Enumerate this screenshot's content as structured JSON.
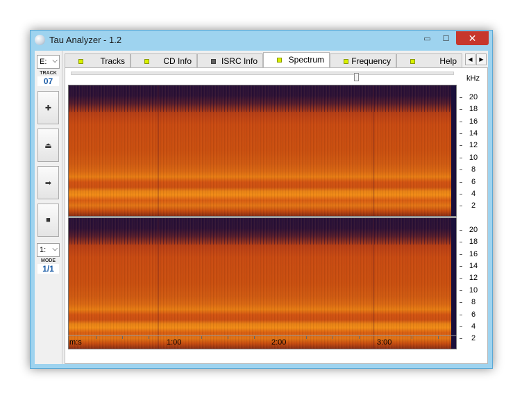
{
  "window": {
    "title": "Tau Analyzer - 1.2",
    "controls": {
      "minimize": "▭",
      "maximize": "☐",
      "close": "✕"
    }
  },
  "sidebar": {
    "drive_value": "E:",
    "track_label": "TRACK",
    "track_value": "07",
    "buttons": [
      {
        "name": "add-button",
        "glyph": "✚"
      },
      {
        "name": "eject-button",
        "glyph": "⏏"
      },
      {
        "name": "play-button",
        "glyph": "➡"
      },
      {
        "name": "stop-button",
        "glyph": "■"
      }
    ],
    "mode_select_value": "1:",
    "mode_label": "MODE",
    "mode_value": "1/1"
  },
  "tabs": [
    {
      "label": "Tracks",
      "indicator": "yellow",
      "active": false
    },
    {
      "label": "CD Info",
      "indicator": "yellow",
      "active": false
    },
    {
      "label": "ISRC Info",
      "indicator": "grey",
      "active": false
    },
    {
      "label": "Spectrum",
      "indicator": "yellow",
      "active": true
    },
    {
      "label": "Frequency",
      "indicator": "yellow",
      "active": false
    },
    {
      "label": "Help",
      "indicator": "yellow",
      "active": false
    }
  ],
  "tab_scroll": {
    "left": "◀",
    "right": "▶"
  },
  "spectrum": {
    "position_fraction": 0.75,
    "unit": "kHz",
    "freq_ticks": [
      "20",
      "18",
      "16",
      "14",
      "12",
      "10",
      "8",
      "6",
      "4",
      "2"
    ],
    "time_axis_label": "m:s",
    "time_ticks": [
      "1:00",
      "2:00",
      "3:00"
    ],
    "colors": {
      "background": "#2a1238",
      "mid": "#c94f10",
      "high": "#f18c17"
    }
  }
}
